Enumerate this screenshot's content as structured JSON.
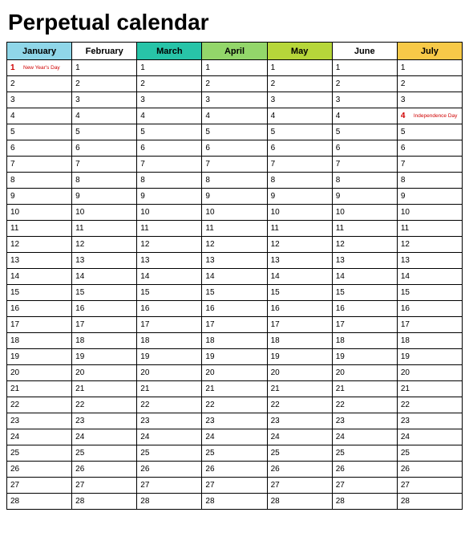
{
  "title": "Perpetual calendar",
  "months": [
    {
      "name": "January",
      "color": "#8fd6e8"
    },
    {
      "name": "February",
      "color": "#ffffff"
    },
    {
      "name": "March",
      "color": "#28c4a8"
    },
    {
      "name": "April",
      "color": "#93d66a"
    },
    {
      "name": "May",
      "color": "#b6d63a"
    },
    {
      "name": "June",
      "color": "#ffffff"
    },
    {
      "name": "July",
      "color": "#f7c948"
    }
  ],
  "holidays": {
    "January": {
      "1": "New Year's Day"
    },
    "July": {
      "4": "Independence Day"
    }
  },
  "day_start": 1,
  "day_end": 28
}
